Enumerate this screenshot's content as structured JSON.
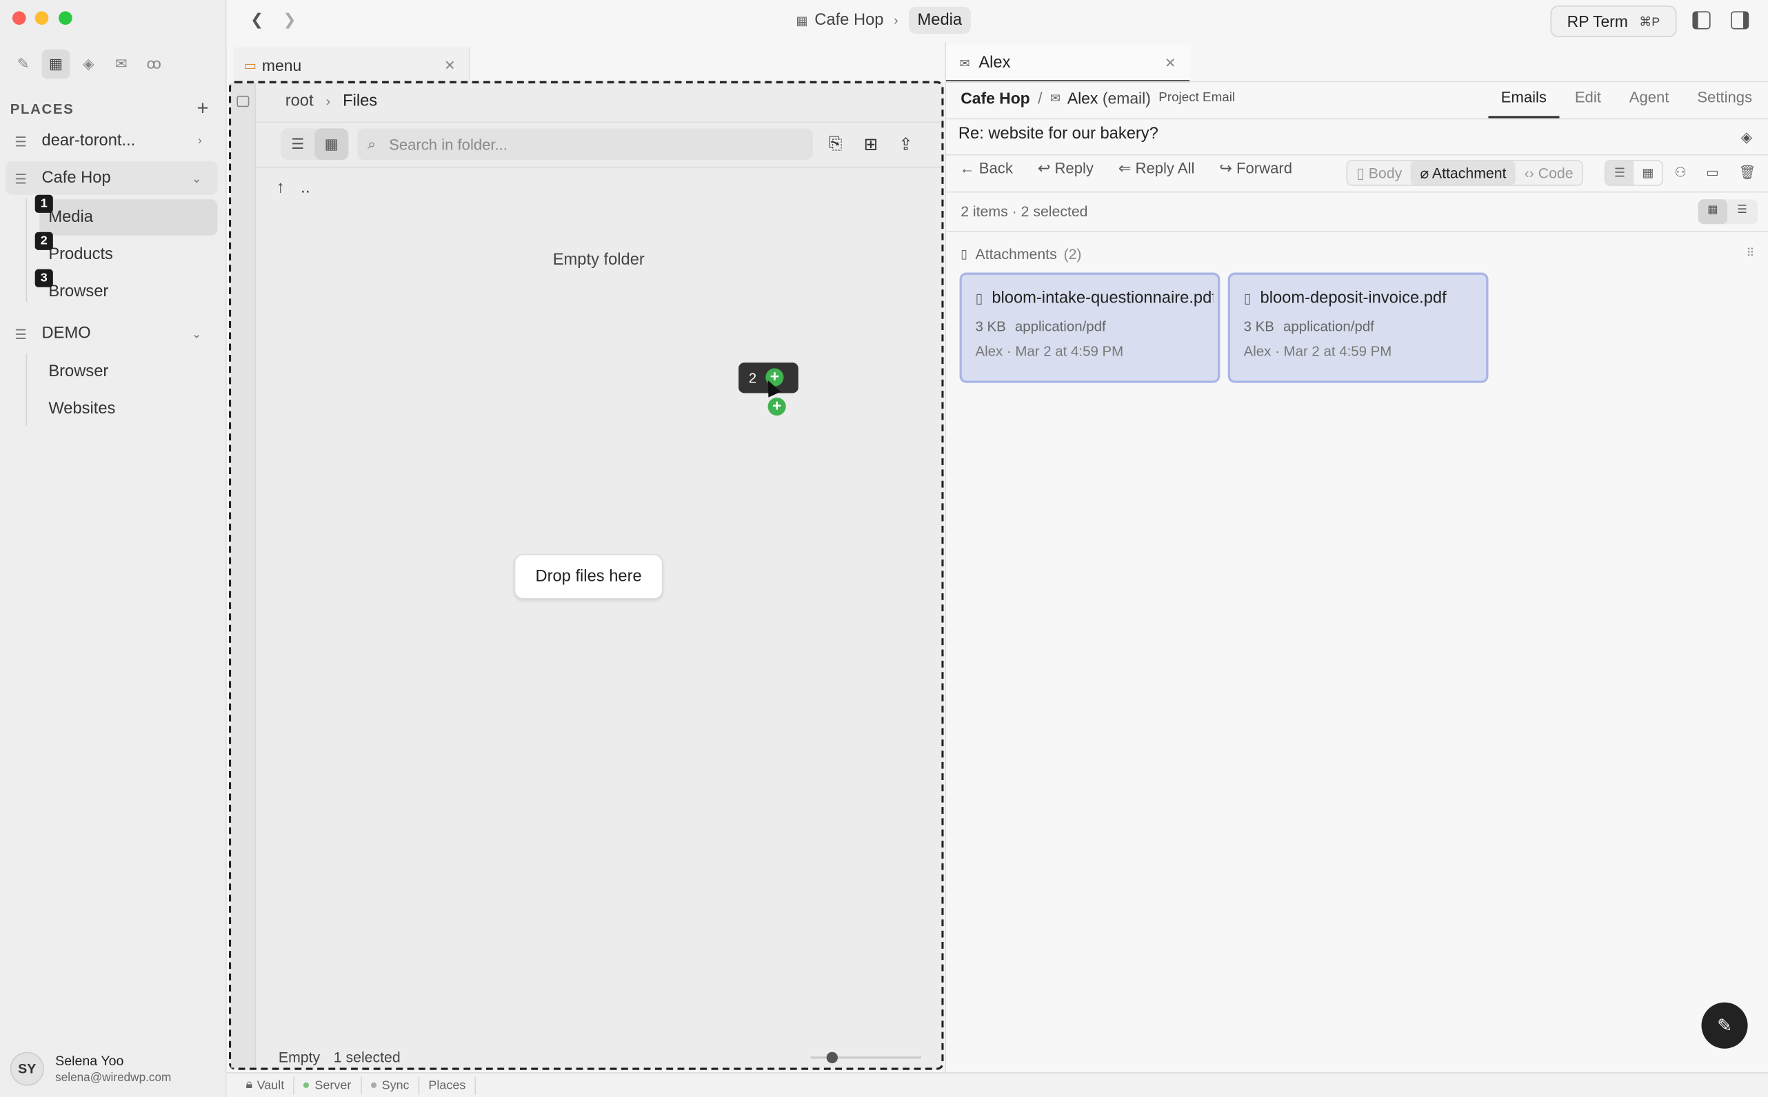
{
  "sidebar": {
    "places_title": "PLACES",
    "places": [
      {
        "label": "dear-toront..."
      },
      {
        "label": "Cafe Hop",
        "children": [
          {
            "label": "Media",
            "shortcut": "1"
          },
          {
            "label": "Products",
            "shortcut": "2"
          },
          {
            "label": "Browser",
            "shortcut": "3"
          }
        ]
      },
      {
        "label": "DEMO",
        "children": [
          {
            "label": "Browser"
          },
          {
            "label": "Websites"
          }
        ]
      }
    ],
    "user": {
      "initials": "SY",
      "name": "Selena Yoo",
      "email": "selena@wiredwp.com"
    }
  },
  "topbar": {
    "breadcrumb": [
      "Cafe Hop",
      "Media"
    ],
    "rpterm_label": "RP Term",
    "rpterm_shortcut": "⌘P"
  },
  "left_pane": {
    "tab_label": "menu",
    "path": [
      "root",
      "Files"
    ],
    "search_placeholder": "Search in folder...",
    "updir_label": "..",
    "empty_text": "Empty folder",
    "drop_hint": "Drop files here",
    "drag_count": "2",
    "status": {
      "state": "Empty",
      "selection": "1 selected"
    }
  },
  "right_pane": {
    "tab_label": "Alex",
    "breadcrumb": {
      "place": "Cafe Hop",
      "item": "Alex",
      "item_suffix": "(email)",
      "type": "Project Email"
    },
    "tabs": [
      "Emails",
      "Edit",
      "Agent",
      "Settings"
    ],
    "active_tab": "Emails",
    "subject": "Re: website for our bakery?",
    "actions": [
      "Back",
      "Reply",
      "Reply All",
      "Forward"
    ],
    "view_modes": [
      "Body",
      "Attachment",
      "Code"
    ],
    "active_view": "Attachment",
    "items_summary": "2 items · 2 selected",
    "attachments_title": "Attachments",
    "attachments_count": "(2)",
    "attachments": [
      {
        "name": "bloom-intake-questionnaire.pdf",
        "size": "3 KB",
        "mime": "application/pdf",
        "meta": "Alex · Mar 2 at 4:59 PM"
      },
      {
        "name": "bloom-deposit-invoice.pdf",
        "size": "3 KB",
        "mime": "application/pdf",
        "meta": "Alex · Mar 2 at 4:59 PM"
      }
    ]
  },
  "statusbar": [
    "Vault",
    "Server",
    "Sync",
    "Places"
  ],
  "colors": {
    "selection_fill": "#d8ddef",
    "selection_border": "#aab5e6",
    "drop_plus": "#3fb34f"
  }
}
